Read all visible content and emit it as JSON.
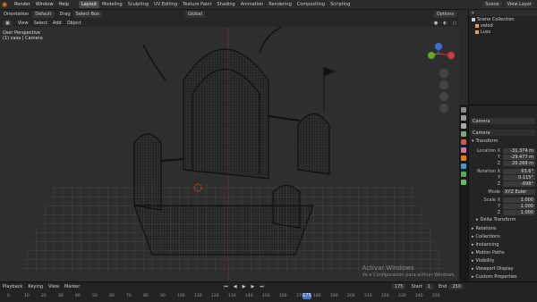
{
  "topbar": {
    "menus": [
      "Render",
      "Window",
      "Help"
    ],
    "workspaces": [
      "Layout",
      "Modeling",
      "Sculpting",
      "UV Editing",
      "Texture Paint",
      "Shading",
      "Animation",
      "Rendering",
      "Compositing",
      "Scripting"
    ],
    "active_workspace": "Layout",
    "scene": "Scene",
    "view_layer": "View Layer"
  },
  "header2": {
    "orientation_label": "Orientation",
    "orientation_value": "Default",
    "drag_label": "Drag",
    "select_value": "Select Box",
    "transform_value": "Global",
    "options_label": "Options"
  },
  "header3": {
    "items": [
      "View",
      "Select",
      "Add",
      "Object"
    ]
  },
  "viewport": {
    "view_name": "User Perspective",
    "object_line": "(1) casa | Camera"
  },
  "watermark": {
    "line1": "Activar Windows",
    "line2": "Ve a Configuración para activar Windows."
  },
  "outliner": {
    "root": "Scene Collection",
    "items": [
      {
        "label": "velod",
        "color": "#e0a060"
      },
      {
        "label": "Luss",
        "color": "#e0a060"
      }
    ]
  },
  "properties": {
    "object_name": "Camera",
    "data_name": "Camera",
    "transform_title": "Transform",
    "location": {
      "label": "Location X",
      "x": "-31.374 m",
      "y": "-29.477 m",
      "z": "20.268 m"
    },
    "rotation": {
      "label": "Rotation X",
      "x": "63.6°",
      "y": "0.115°",
      "z": "-698°"
    },
    "mode_label": "Mode",
    "mode_value": "XYZ Euler",
    "scale": {
      "label": "Scale X",
      "x": "1.000",
      "y": "1.000",
      "z": "1.000"
    },
    "sections": [
      "Delta Transform",
      "Relations",
      "Collections",
      "Instancing",
      "Motion Paths",
      "Visibility",
      "Viewport Display",
      "Custom Properties"
    ],
    "axis_y": "Y",
    "axis_z": "Z"
  },
  "timeline": {
    "header_items": [
      "Playback",
      "Keying",
      "View",
      "Marker"
    ],
    "current_frame": "175",
    "start_label": "Start",
    "start_value": "1",
    "end_label": "End",
    "end_value": "250",
    "ticks": [
      "0",
      "10",
      "20",
      "30",
      "40",
      "50",
      "60",
      "70",
      "80",
      "90",
      "100",
      "110",
      "120",
      "130",
      "140",
      "150",
      "160",
      "170",
      "180",
      "190",
      "200",
      "210",
      "220",
      "230",
      "240",
      "250"
    ],
    "playhead_label": "175"
  },
  "colors": {
    "accent": "#4772b3",
    "orange": "#e87d0d",
    "wire": "#0a0a0a"
  }
}
